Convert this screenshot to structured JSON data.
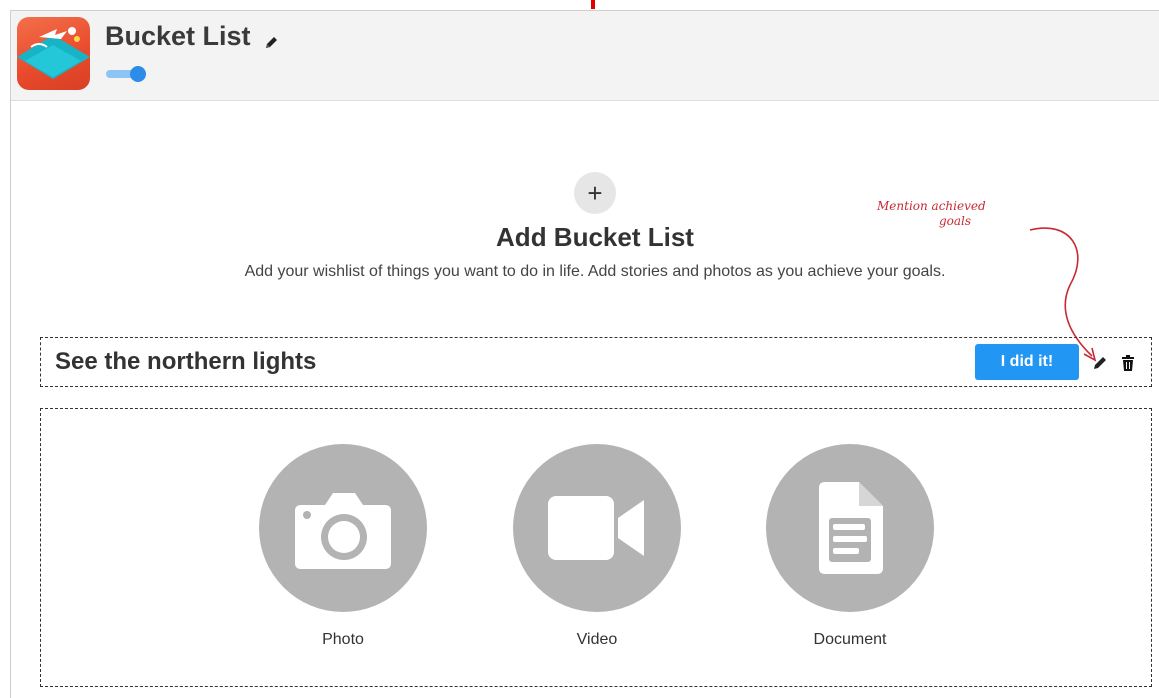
{
  "header": {
    "title": "Bucket List",
    "app_icon": "bucket-list-app-icon",
    "edit_icon": "pencil-icon",
    "toggle_on": true
  },
  "add_section": {
    "button_icon": "+",
    "title": "Add Bucket List",
    "description": "Add your wishlist of things you want to do in life. Add stories and photos as you achieve your goals."
  },
  "annotation": {
    "line1": "Mention achieved",
    "line2": "goals",
    "color": "#c72a35"
  },
  "goal": {
    "title": "See the northern lights",
    "did_it_label": "I did it!",
    "edit_icon": "pencil-icon",
    "delete_icon": "trash-icon"
  },
  "media": [
    {
      "label": "Photo",
      "icon": "camera-icon"
    },
    {
      "label": "Video",
      "icon": "video-camera-icon"
    },
    {
      "label": "Document",
      "icon": "document-icon"
    }
  ],
  "colors": {
    "accent": "#2196f3",
    "toggle": "#2b8de8",
    "media_circle": "#b3b3b3"
  }
}
